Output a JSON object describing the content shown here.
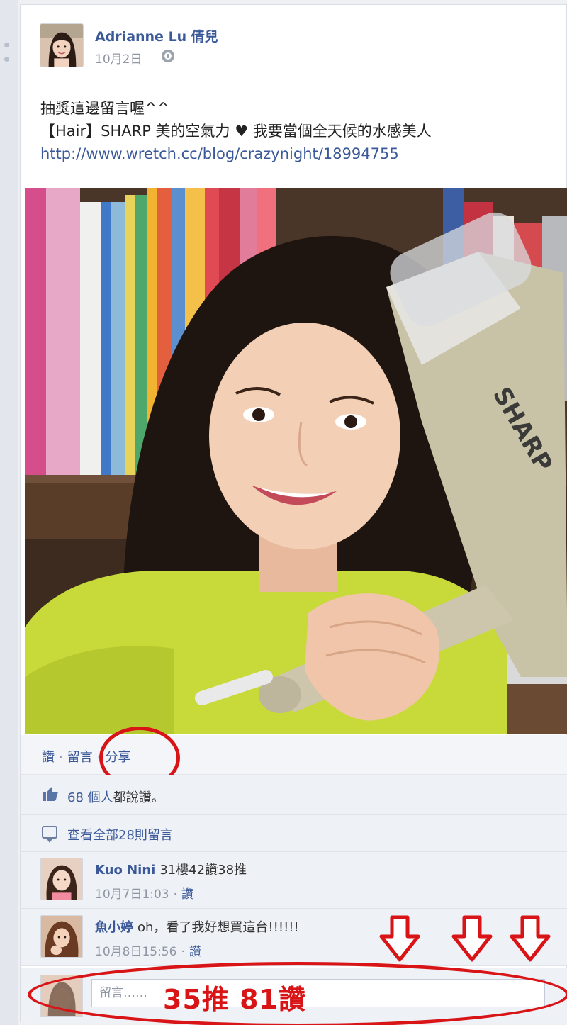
{
  "post": {
    "author": "Adrianne Lu 倩兒",
    "date": "10月2日",
    "text_line1": "抽獎這邊留言喔^^",
    "text_line2": "【Hair】SHARP 美的空氣力 ♥ 我要當個全天候的水感美人",
    "link": "http://www.wretch.cc/blog/crazynight/18994755",
    "photo_brand": "SHARP"
  },
  "actions": {
    "like": "讚",
    "comment": "留言",
    "share": "分享",
    "separator": "·"
  },
  "likes": {
    "count_text": "68 個人",
    "suffix": "都說讚。"
  },
  "comments_link": "查看全部28則留言",
  "comments": [
    {
      "author": "Kuo Nini",
      "text": "31樓42讚38推",
      "time": "10月7日1:03",
      "like": "讚"
    },
    {
      "author": "魚小婷",
      "text": "oh，看了我好想買這台!!!!!!",
      "time": "10月8日15:56",
      "like": "讚"
    }
  ],
  "comment_input": {
    "placeholder": "留言……"
  },
  "annotation": {
    "stats": "35推 81讚"
  },
  "colors": {
    "link_blue": "#3b5998",
    "annotation_red": "#d81417"
  },
  "icons": [
    "globe-icon",
    "thumbs-up-icon",
    "comment-bubble-icon",
    "down-arrow-icon"
  ]
}
